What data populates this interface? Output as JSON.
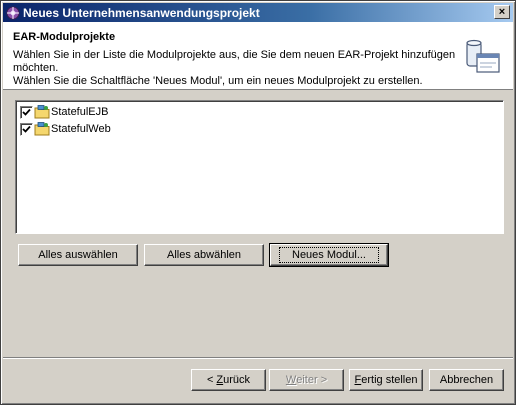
{
  "window": {
    "title": "Neues Unternehmensanwendungsprojekt",
    "close_label": "×"
  },
  "header": {
    "title": "EAR-Modulprojekte",
    "description_lines": [
      "Wählen Sie in der Liste die Modulprojekte aus, die Sie dem neuen EAR-Projekt hinzufügen",
      "möchten.",
      "Wählen Sie die Schaltfläche 'Neues Modul', um ein neues Modulprojekt zu erstellen."
    ]
  },
  "modules": [
    {
      "name": "StatefulEJB",
      "checked": true
    },
    {
      "name": "StatefulWeb",
      "checked": true
    }
  ],
  "list_buttons": {
    "select_all": "Alles auswählen",
    "deselect_all": "Alles abwählen",
    "new_module": "Neues Modul..."
  },
  "footer": {
    "back": {
      "mnemonic": "Z",
      "rest": "urück",
      "prefix": "< "
    },
    "next": {
      "mnemonic": "W",
      "rest": "eiter >",
      "disabled": true
    },
    "finish": {
      "mnemonic": "F",
      "rest": "ertig stellen"
    },
    "cancel": "Abbrechen"
  },
  "colors": {
    "title_start": "#0a246a",
    "title_end": "#a6caf0",
    "face": "#d4d0c8"
  },
  "icons": {
    "app": "eclipse-icon",
    "wizard": "ear-project-wizard-icon",
    "project": "project-folder-icon",
    "check": "checkmark-icon"
  }
}
